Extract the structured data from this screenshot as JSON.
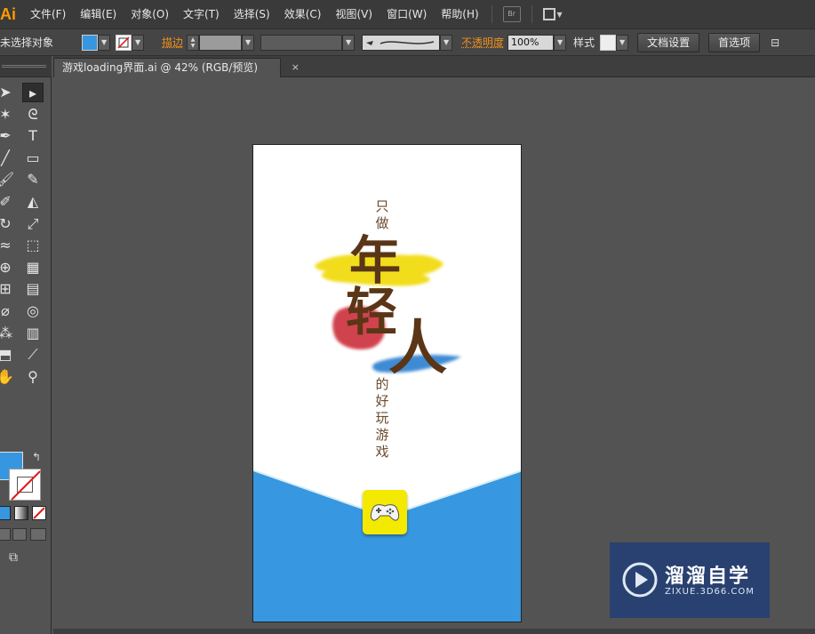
{
  "app": {
    "logo": "Ai"
  },
  "menu": {
    "items": [
      "文件(F)",
      "编辑(E)",
      "对象(O)",
      "文字(T)",
      "选择(S)",
      "效果(C)",
      "视图(V)",
      "窗口(W)",
      "帮助(H)"
    ],
    "bridge_label": "Br"
  },
  "control": {
    "selection_status": "未选择对象",
    "fill_color": "#3697e0",
    "stroke_label": "描边",
    "opacity_label": "不透明度",
    "opacity_value": "100%",
    "style_label": "样式",
    "doc_setup_button": "文档设置",
    "preferences_button": "首选项"
  },
  "tab": {
    "title": "游戏loading界面.ai @ 42% (RGB/预览)",
    "close": "×"
  },
  "artwork": {
    "line_top": [
      "只",
      "做"
    ],
    "big_chars": [
      "年",
      "轻",
      "人"
    ],
    "line_bottom": [
      "的",
      "好",
      "玩",
      "游",
      "戏"
    ],
    "band_color": "#3797e0",
    "icon_color": "#f4e900",
    "brush_colors": {
      "yellow": "#f2dd1c",
      "red": "#c8232e",
      "blue": "#2a7fd0"
    }
  },
  "tools": {
    "icons": [
      "selection-tool-icon",
      "direct-selection-tool-icon",
      "magic-wand-tool-icon",
      "lasso-tool-icon",
      "pen-tool-icon",
      "type-tool-icon",
      "line-segment-tool-icon",
      "rectangle-tool-icon",
      "paintbrush-tool-icon",
      "pencil-tool-icon",
      "blob-brush-tool-icon",
      "eraser-tool-icon",
      "rotate-tool-icon",
      "scale-tool-icon",
      "warp-tool-icon",
      "free-transform-tool-icon",
      "shape-builder-tool-icon",
      "perspective-grid-tool-icon",
      "mesh-tool-icon",
      "gradient-tool-icon",
      "eyedropper-tool-icon",
      "blend-tool-icon",
      "symbol-sprayer-tool-icon",
      "column-graph-tool-icon",
      "artboard-tool-icon",
      "slice-tool-icon",
      "hand-tool-icon",
      "zoom-tool-icon"
    ]
  },
  "watermark": {
    "title": "溜溜自学",
    "subtitle": "ZIXUE.3D66.COM"
  }
}
